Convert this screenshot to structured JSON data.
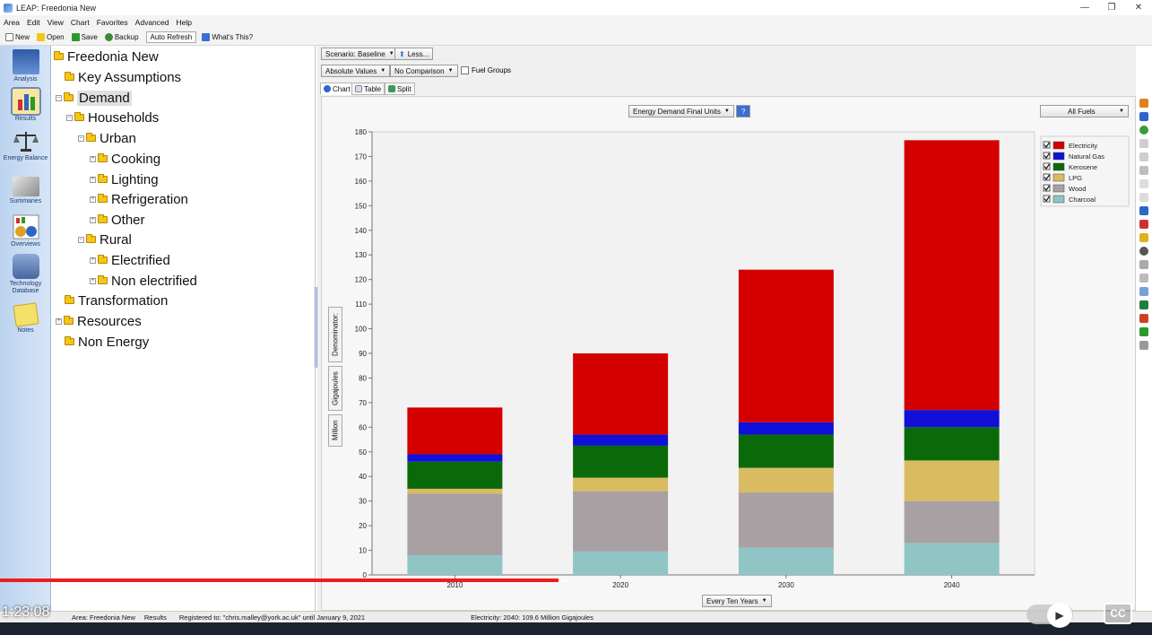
{
  "window": {
    "title": "LEAP: Freedonia New"
  },
  "menu": [
    "Area",
    "Edit",
    "View",
    "Chart",
    "Favorites",
    "Advanced",
    "Help"
  ],
  "toolbar": {
    "new": "New",
    "open": "Open",
    "save": "Save",
    "backup": "Backup",
    "auto_refresh": "Auto Refresh",
    "whats_this": "What's This?"
  },
  "vnav": [
    {
      "label": "Analysis",
      "icon": "analysis-icon"
    },
    {
      "label": "Results",
      "icon": "results-icon"
    },
    {
      "label": "Energy Balance",
      "icon": "energy-balance-icon"
    },
    {
      "label": "Summaries",
      "icon": "summaries-icon"
    },
    {
      "label": "Overviews",
      "icon": "overviews-icon"
    },
    {
      "label": "Technology Database",
      "icon": "technology-database-icon"
    },
    {
      "label": "Notes",
      "icon": "notes-icon"
    }
  ],
  "tree": [
    "Freedonia New",
    "Key Assumptions",
    "Demand",
    "Households",
    "Urban",
    "Cooking",
    "Lighting",
    "Refrigeration",
    "Other",
    "Rural",
    "Electrified",
    "Non electrified",
    "Transformation",
    "Resources",
    "Non Energy"
  ],
  "controls": {
    "scenario": "Scenario: Baseline",
    "less": "Less...",
    "absolute_values": "Absolute Values",
    "no_comparison": "No Comparison",
    "fuel_groups": "Fuel Groups",
    "tab_chart": "Chart",
    "tab_table": "Table",
    "tab_split": "Split",
    "measure": "Energy Demand Final Units",
    "help_q": "?",
    "all_fuels": "All Fuels",
    "interval": "Every Ten Years"
  },
  "side_tabs": {
    "denominator": "Denominator:",
    "gigajoules": "Gigajoules",
    "million": "Million"
  },
  "chart_data": {
    "type": "bar",
    "stacked": true,
    "categories": [
      "2010",
      "2020",
      "2030",
      "2040"
    ],
    "ylim": [
      0,
      180
    ],
    "yticks": [
      0,
      10,
      20,
      30,
      40,
      50,
      60,
      70,
      80,
      90,
      100,
      110,
      120,
      130,
      140,
      150,
      160,
      170,
      180
    ],
    "legend_position": "top-right",
    "series": [
      {
        "name": "Charcoal",
        "color": "#8fc5c5",
        "values": [
          8,
          9.5,
          11,
          13
        ]
      },
      {
        "name": "Wood",
        "color": "#a8a0a2",
        "values": [
          25,
          24.5,
          22.5,
          17
        ]
      },
      {
        "name": "LPG",
        "color": "#d9bb62",
        "values": [
          2,
          5.5,
          10,
          16.5
        ]
      },
      {
        "name": "Kerosene",
        "color": "#0a6a0a",
        "values": [
          11,
          13,
          13.5,
          13.5
        ]
      },
      {
        "name": "Natural Gas",
        "color": "#1010d8",
        "values": [
          3,
          4.5,
          5,
          7
        ]
      },
      {
        "name": "Electricity",
        "color": "#d40000",
        "values": [
          19,
          33,
          62,
          109.6
        ]
      }
    ],
    "legend_order": [
      "Electricity",
      "Natural Gas",
      "Kerosene",
      "LPG",
      "Wood",
      "Charcoal"
    ]
  },
  "status": {
    "area": "Area: Freedonia New",
    "view": "Results",
    "registered": "Registered to: \"chris.malley@york.ac.uk\" until January 9, 2021",
    "hover": "Electricity: 2040: 109.6 Million Gigajoules"
  },
  "video": {
    "timecode": "1:23:08",
    "progress": 0.485,
    "cc": "CC"
  }
}
